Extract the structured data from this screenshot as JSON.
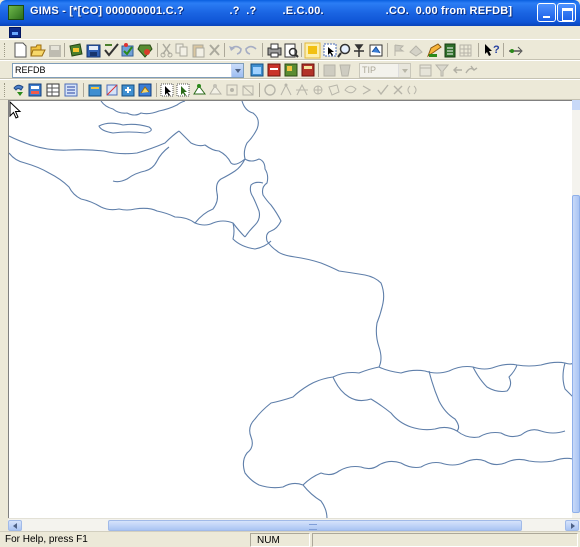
{
  "window": {
    "title": "GIMS - [*[CO] 000000001.C.?              .?  .?        .E.C.00.                   .CO.  0.00 from REFDB]",
    "app_icon": "gims-app-icon",
    "controls": [
      "minimize-icon",
      "maximize-icon"
    ]
  },
  "toolbar_top": {
    "icons": [
      "new-file-icon",
      "open-folder-icon",
      "save-disk-icon",
      "object-edit-icon",
      "save-all-icon",
      "check-icon",
      "validate-icon",
      "tool-icon",
      "cut-icon",
      "copy-icon",
      "paste-icon",
      "delete-icon",
      "undo-icon",
      "redo-icon",
      "print-icon",
      "print-preview-icon",
      "highlight-icon",
      "select-icon",
      "zoom-icon",
      "pan-icon",
      "map-icon",
      "flag-icon",
      "layer-icon",
      "edit-icon",
      "legend-icon",
      "grid-icon",
      "context-help-icon",
      "connect-icon"
    ]
  },
  "toolbar_mid": {
    "database_combo": "REFDB",
    "tip_combo": "TIP",
    "icons": [
      "object-icon",
      "object-red-icon",
      "layer-props-icon",
      "tree-icon",
      "object-disabled-icon",
      "object-disabled-2-icon",
      "calendar-icon",
      "filter-icon",
      "back-arrow-icon",
      "forward-arrow-icon"
    ]
  },
  "toolbar_edit": {
    "icons": [
      "rotate-icon",
      "query-icon",
      "table-icon",
      "list-icon",
      "object-sel-icon",
      "split-icon",
      "merge-icon",
      "spatial-icon",
      "pointer-icon",
      "move-vertex-icon",
      "add-vertex-icon",
      "delete-vertex-icon",
      "snap-icon",
      "topology-icon",
      "circle-icon",
      "vertex-icon",
      "edge-icon",
      "node-icon",
      "area-icon",
      "polygon-icon",
      "greater-icon",
      "accept-check-icon",
      "reject-x-icon",
      "undo-curve-icon"
    ]
  },
  "map": {
    "canvas": "map-boundary-view",
    "line_color": "#5f7faa"
  },
  "statusbar": {
    "help_text": "For Help, press F1",
    "num_indicator": "NUM"
  }
}
